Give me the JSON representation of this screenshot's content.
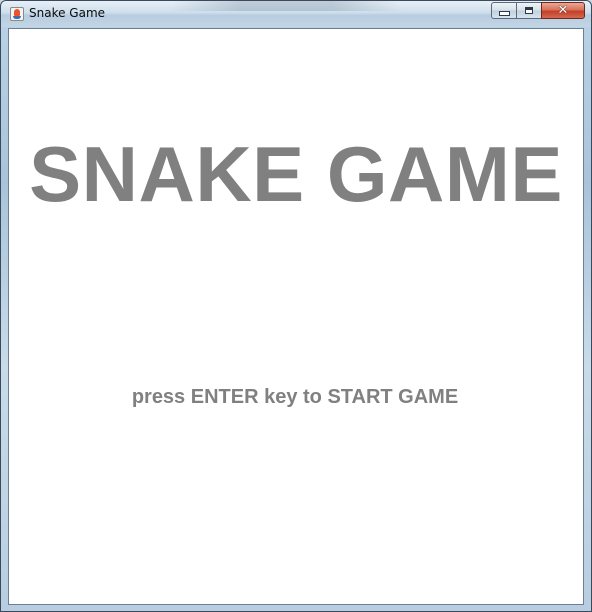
{
  "window": {
    "title": "Snake Game",
    "controls": {
      "minimize_icon": "minimize-icon",
      "maximize_icon": "maximize-icon",
      "close_glyph": "✕"
    }
  },
  "game": {
    "title": "SNAKE GAME",
    "start_prompt": "press ENTER key to START GAME",
    "text_color": "#808080",
    "background_color": "#ffffff"
  }
}
